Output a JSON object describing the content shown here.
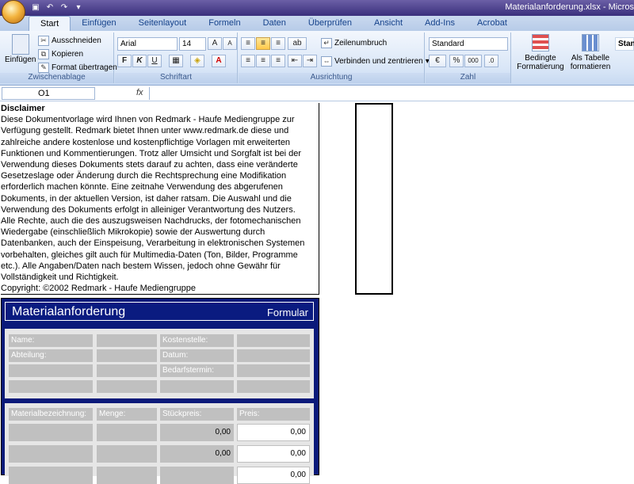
{
  "window": {
    "title": "Materialanforderung.xlsx - Micros"
  },
  "tabs": [
    "Start",
    "Einfügen",
    "Seitenlayout",
    "Formeln",
    "Daten",
    "Überprüfen",
    "Ansicht",
    "Add-Ins",
    "Acrobat"
  ],
  "clipboard": {
    "paste": "Einfügen",
    "cut": "Ausschneiden",
    "copy": "Kopieren",
    "format_painter": "Format übertragen",
    "label": "Zwischenablage"
  },
  "font": {
    "name": "Arial",
    "size": "14",
    "bold": "F",
    "italic": "K",
    "underline": "U",
    "label": "Schriftart"
  },
  "alignment": {
    "wrap": "Zeilenumbruch",
    "merge": "Verbinden und zentrieren",
    "label": "Ausrichtung"
  },
  "number": {
    "format": "Standard",
    "percent": "%",
    "thousands": "000",
    "label": "Zahl"
  },
  "styles": {
    "conditional": "Bedingte Formatierung",
    "as_table": "Als Tabelle formatieren",
    "cell_style": "Stan"
  },
  "formula_bar": {
    "name_box": "O1",
    "fx": "fx"
  },
  "disclaimer": {
    "title": "Disclaimer",
    "lines": [
      "Diese Dokumentvorlage wird Ihnen von Redmark - Haufe Mediengruppe zur",
      "Verfügung gestellt. Redmark bietet Ihnen unter www.redmark.de diese und",
      "zahlreiche andere kostenlose und kostenpflichtige Vorlagen mit erweiterten",
      "Funktionen und Kommentierungen. Trotz aller Umsicht und Sorgfalt ist bei der",
      "Verwendung dieses Dokuments stets darauf zu achten, dass eine veränderte",
      "Gesetzeslage oder Änderung durch die Rechtsprechung eine Modifikation",
      "erforderlich machen könnte. Eine zeitnahe Verwendung des abgerufenen",
      "Dokuments, in der aktuellen Version, ist daher ratsam. Die Auswahl und die",
      "Verwendung des Dokuments erfolgt in alleiniger Verantwortung des Nutzers.",
      "Alle Rechte, auch die des auszugsweisen Nachdrucks, der fotomechanischen",
      "Wiedergabe (einschließlich Mikrokopie) sowie der Auswertung durch",
      "Datenbanken, auch der Einspeisung, Verarbeitung in elektronischen Systemen",
      "vorbehalten, gleiches gilt auch für Multimedia-Daten (Ton, Bilder, Programme",
      "etc.). Alle Angaben/Daten nach bestem Wissen, jedoch ohne Gewähr für",
      "Vollständigkeit und Richtigkeit.",
      "Copyright: ©2002 Redmark - Haufe Mediengruppe"
    ]
  },
  "form": {
    "title": "Materialanforderung",
    "subtitle": "Formular",
    "name": "Name:",
    "cost_center": "Kostenstelle:",
    "department": "Abteilung:",
    "date": "Datum:",
    "need_date": "Bedarfstermin:",
    "col_material": "Materialbezeichnung:",
    "col_qty": "Menge:",
    "col_unit_price": "Stückpreis:",
    "col_price": "Preis:",
    "rows": [
      {
        "unit": "0,00",
        "price": "0,00"
      },
      {
        "unit": "0,00",
        "price": "0,00"
      },
      {
        "unit": "",
        "price": "0,00"
      }
    ]
  }
}
